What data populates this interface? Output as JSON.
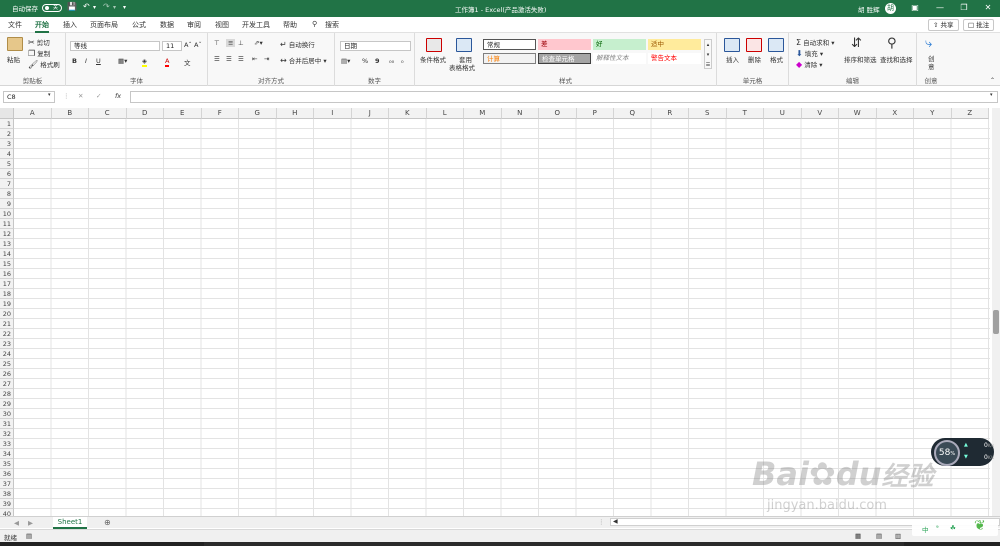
{
  "titlebar": {
    "autosave_label": "自动保存",
    "autosave_state": "关",
    "title": "工作簿1 - Excel(产品激活失败)",
    "user": "胡 胜辉",
    "avatar": "胡"
  },
  "tabs": [
    "文件",
    "开始",
    "插入",
    "页面布局",
    "公式",
    "数据",
    "审阅",
    "视图",
    "开发工具",
    "帮助"
  ],
  "search_label": "搜索",
  "share_label": "共享",
  "comment_label": "批注",
  "ribbon": {
    "clipboard": {
      "label": "剪贴板",
      "paste": "粘贴",
      "cut": "剪切",
      "copy": "复制",
      "format_painter": "格式刷"
    },
    "font": {
      "label": "字体",
      "font_name": "等线",
      "font_size": "11",
      "bold": "B",
      "italic": "I",
      "underline": "U"
    },
    "alignment": {
      "label": "对齐方式",
      "wrap": "自动换行",
      "merge": "合并后居中"
    },
    "number": {
      "label": "数字",
      "format": "日期",
      "percent": "%",
      "comma": "9"
    },
    "styles": {
      "label": "样式",
      "cond_format": "条件格式",
      "table_format_1": "套用",
      "table_format_2": "表格格式",
      "cells": [
        {
          "text": "常规",
          "bg": "#ffffff",
          "fg": "#222222"
        },
        {
          "text": "差",
          "bg": "#ffc7ce",
          "fg": "#9c0006"
        },
        {
          "text": "好",
          "bg": "#c6efce",
          "fg": "#006100"
        },
        {
          "text": "适中",
          "bg": "#ffeb9c",
          "fg": "#9c5700"
        },
        {
          "text": "计算",
          "bg": "#f2f2f2",
          "fg": "#fa7d00"
        },
        {
          "text": "检查单元格",
          "bg": "#a5a5a5",
          "fg": "#ffffff"
        },
        {
          "text": "解释性文本",
          "bg": "#ffffff",
          "fg": "#7f7f7f"
        },
        {
          "text": "警告文本",
          "bg": "#ffffff",
          "fg": "#ff0000"
        }
      ]
    },
    "cells_group": {
      "label": "单元格",
      "insert": "插入",
      "delete": "删除",
      "format": "格式"
    },
    "editing": {
      "label": "编辑",
      "autosum": "自动求和",
      "fill": "填充",
      "clear": "清除",
      "sort": "排序和筛选",
      "find": "查找和选择"
    },
    "ideas": {
      "label": "创意",
      "ideas_1": "创",
      "ideas_2": "意"
    }
  },
  "formula_bar": {
    "name_box": "C8",
    "fx": "fx",
    "cancel": "✕",
    "enter": "✓"
  },
  "columns": [
    "A",
    "B",
    "C",
    "D",
    "E",
    "F",
    "G",
    "H",
    "I",
    "J",
    "K",
    "L",
    "M",
    "N",
    "O",
    "P",
    "Q",
    "R",
    "S",
    "T",
    "U",
    "V",
    "W",
    "X",
    "Y",
    "Z"
  ],
  "rows": [
    "1",
    "2",
    "3",
    "4",
    "5",
    "6",
    "7",
    "8",
    "9",
    "10",
    "11",
    "12",
    "13",
    "14",
    "15",
    "16",
    "17",
    "18",
    "19",
    "20",
    "21",
    "22",
    "23",
    "24",
    "25",
    "26",
    "27",
    "28",
    "29",
    "30",
    "31",
    "32",
    "33",
    "34",
    "35",
    "36",
    "37",
    "38",
    "39",
    "40"
  ],
  "sheet_tab": "Sheet1",
  "status": {
    "ready": "就绪"
  },
  "widget": {
    "percent": "58",
    "unit": "%",
    "up": "0",
    "up_unit": "K/s",
    "down": "0",
    "down_unit": "K/s"
  },
  "watermark": {
    "text1": "Bai",
    "text2": "du",
    "text3": "经验",
    "url": "jingyan.baidu.com"
  },
  "tray": {
    "lang": "中"
  }
}
